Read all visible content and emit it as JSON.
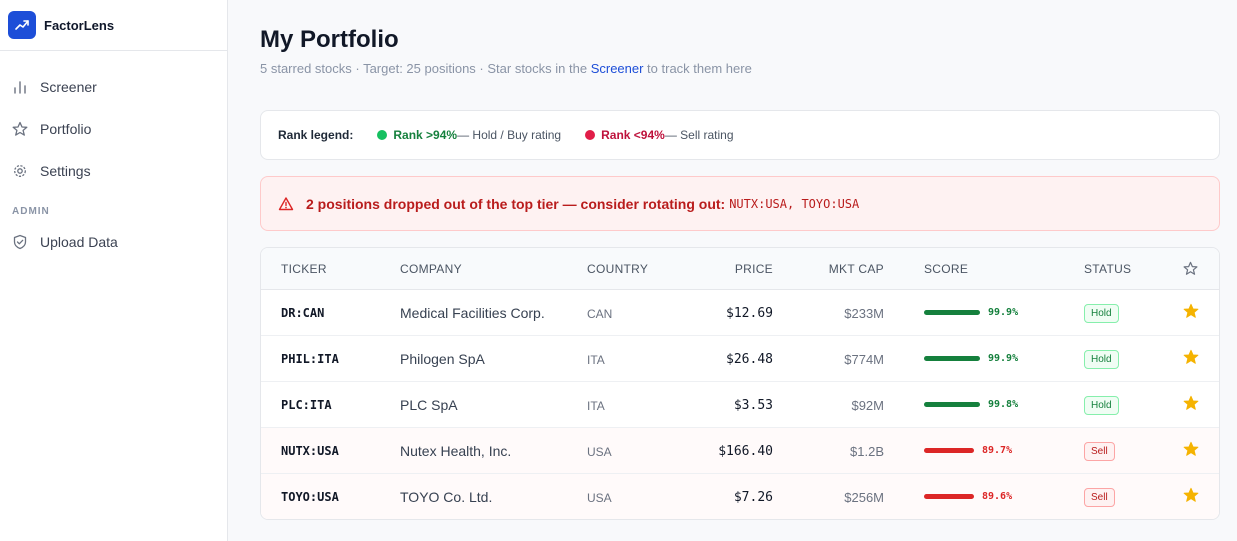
{
  "app": {
    "name": "FactorLens"
  },
  "sidebar": {
    "items": [
      {
        "label": "Screener",
        "icon": "bar-chart-icon"
      },
      {
        "label": "Portfolio",
        "icon": "star-icon"
      },
      {
        "label": "Settings",
        "icon": "gear-icon"
      }
    ],
    "admin_title": "ADMIN",
    "admin_items": [
      {
        "label": "Upload Data",
        "icon": "shield-icon"
      }
    ]
  },
  "header": {
    "title": "My Portfolio",
    "subtitle_pre": "5 starred stocks · Target: 25 positions · Star stocks in the ",
    "subtitle_link": "Screener",
    "subtitle_post": " to track them here"
  },
  "legend": {
    "title": "Rank legend:",
    "green_label": "Rank >94%",
    "green_desc": " — Hold / Buy rating",
    "red_label": "Rank <94%",
    "red_desc": " — Sell rating"
  },
  "alert": {
    "text": "2 positions dropped out of the top tier — consider rotating out:",
    "codes": "NUTX:USA, TOYO:USA"
  },
  "table": {
    "headers": {
      "ticker": "TICKER",
      "company": "COMPANY",
      "country": "COUNTRY",
      "price": "PRICE",
      "mktcap": "MKT CAP",
      "score": "SCORE",
      "status": "STATUS"
    },
    "rows": [
      {
        "ticker": "DR:CAN",
        "company": "Medical Facilities Corp.",
        "country": "CAN",
        "price": "$12.69",
        "mktcap": "$233M",
        "score": "99.9%",
        "score_value": 99.9,
        "status": "Hold"
      },
      {
        "ticker": "PHIL:ITA",
        "company": "Philogen SpA",
        "country": "ITA",
        "price": "$26.48",
        "mktcap": "$774M",
        "score": "99.9%",
        "score_value": 99.9,
        "status": "Hold"
      },
      {
        "ticker": "PLC:ITA",
        "company": "PLC SpA",
        "country": "ITA",
        "price": "$3.53",
        "mktcap": "$92M",
        "score": "99.8%",
        "score_value": 99.8,
        "status": "Hold"
      },
      {
        "ticker": "NUTX:USA",
        "company": "Nutex Health, Inc.",
        "country": "USA",
        "price": "$166.40",
        "mktcap": "$1.2B",
        "score": "89.7%",
        "score_value": 89.7,
        "status": "Sell"
      },
      {
        "ticker": "TOYO:USA",
        "company": "TOYO Co. Ltd.",
        "country": "USA",
        "price": "$7.26",
        "mktcap": "$256M",
        "score": "89.6%",
        "score_value": 89.6,
        "status": "Sell"
      }
    ]
  },
  "colors": {
    "accent": "#1d4ed8",
    "hold_green": "#15803d",
    "sell_red": "#dc2626",
    "star_gold": "#f5b301"
  }
}
